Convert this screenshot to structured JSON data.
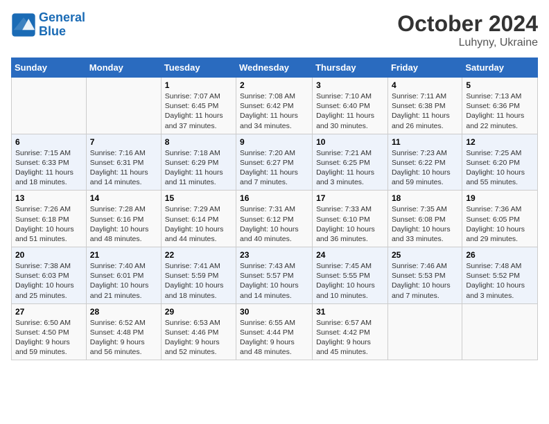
{
  "logo": {
    "line1": "General",
    "line2": "Blue"
  },
  "title": "October 2024",
  "subtitle": "Luhyny, Ukraine",
  "days_header": [
    "Sunday",
    "Monday",
    "Tuesday",
    "Wednesday",
    "Thursday",
    "Friday",
    "Saturday"
  ],
  "weeks": [
    [
      {
        "num": "",
        "info": ""
      },
      {
        "num": "",
        "info": ""
      },
      {
        "num": "1",
        "info": "Sunrise: 7:07 AM\nSunset: 6:45 PM\nDaylight: 11 hours and 37 minutes."
      },
      {
        "num": "2",
        "info": "Sunrise: 7:08 AM\nSunset: 6:42 PM\nDaylight: 11 hours and 34 minutes."
      },
      {
        "num": "3",
        "info": "Sunrise: 7:10 AM\nSunset: 6:40 PM\nDaylight: 11 hours and 30 minutes."
      },
      {
        "num": "4",
        "info": "Sunrise: 7:11 AM\nSunset: 6:38 PM\nDaylight: 11 hours and 26 minutes."
      },
      {
        "num": "5",
        "info": "Sunrise: 7:13 AM\nSunset: 6:36 PM\nDaylight: 11 hours and 22 minutes."
      }
    ],
    [
      {
        "num": "6",
        "info": "Sunrise: 7:15 AM\nSunset: 6:33 PM\nDaylight: 11 hours and 18 minutes."
      },
      {
        "num": "7",
        "info": "Sunrise: 7:16 AM\nSunset: 6:31 PM\nDaylight: 11 hours and 14 minutes."
      },
      {
        "num": "8",
        "info": "Sunrise: 7:18 AM\nSunset: 6:29 PM\nDaylight: 11 hours and 11 minutes."
      },
      {
        "num": "9",
        "info": "Sunrise: 7:20 AM\nSunset: 6:27 PM\nDaylight: 11 hours and 7 minutes."
      },
      {
        "num": "10",
        "info": "Sunrise: 7:21 AM\nSunset: 6:25 PM\nDaylight: 11 hours and 3 minutes."
      },
      {
        "num": "11",
        "info": "Sunrise: 7:23 AM\nSunset: 6:22 PM\nDaylight: 10 hours and 59 minutes."
      },
      {
        "num": "12",
        "info": "Sunrise: 7:25 AM\nSunset: 6:20 PM\nDaylight: 10 hours and 55 minutes."
      }
    ],
    [
      {
        "num": "13",
        "info": "Sunrise: 7:26 AM\nSunset: 6:18 PM\nDaylight: 10 hours and 51 minutes."
      },
      {
        "num": "14",
        "info": "Sunrise: 7:28 AM\nSunset: 6:16 PM\nDaylight: 10 hours and 48 minutes."
      },
      {
        "num": "15",
        "info": "Sunrise: 7:29 AM\nSunset: 6:14 PM\nDaylight: 10 hours and 44 minutes."
      },
      {
        "num": "16",
        "info": "Sunrise: 7:31 AM\nSunset: 6:12 PM\nDaylight: 10 hours and 40 minutes."
      },
      {
        "num": "17",
        "info": "Sunrise: 7:33 AM\nSunset: 6:10 PM\nDaylight: 10 hours and 36 minutes."
      },
      {
        "num": "18",
        "info": "Sunrise: 7:35 AM\nSunset: 6:08 PM\nDaylight: 10 hours and 33 minutes."
      },
      {
        "num": "19",
        "info": "Sunrise: 7:36 AM\nSunset: 6:05 PM\nDaylight: 10 hours and 29 minutes."
      }
    ],
    [
      {
        "num": "20",
        "info": "Sunrise: 7:38 AM\nSunset: 6:03 PM\nDaylight: 10 hours and 25 minutes."
      },
      {
        "num": "21",
        "info": "Sunrise: 7:40 AM\nSunset: 6:01 PM\nDaylight: 10 hours and 21 minutes."
      },
      {
        "num": "22",
        "info": "Sunrise: 7:41 AM\nSunset: 5:59 PM\nDaylight: 10 hours and 18 minutes."
      },
      {
        "num": "23",
        "info": "Sunrise: 7:43 AM\nSunset: 5:57 PM\nDaylight: 10 hours and 14 minutes."
      },
      {
        "num": "24",
        "info": "Sunrise: 7:45 AM\nSunset: 5:55 PM\nDaylight: 10 hours and 10 minutes."
      },
      {
        "num": "25",
        "info": "Sunrise: 7:46 AM\nSunset: 5:53 PM\nDaylight: 10 hours and 7 minutes."
      },
      {
        "num": "26",
        "info": "Sunrise: 7:48 AM\nSunset: 5:52 PM\nDaylight: 10 hours and 3 minutes."
      }
    ],
    [
      {
        "num": "27",
        "info": "Sunrise: 6:50 AM\nSunset: 4:50 PM\nDaylight: 9 hours and 59 minutes."
      },
      {
        "num": "28",
        "info": "Sunrise: 6:52 AM\nSunset: 4:48 PM\nDaylight: 9 hours and 56 minutes."
      },
      {
        "num": "29",
        "info": "Sunrise: 6:53 AM\nSunset: 4:46 PM\nDaylight: 9 hours and 52 minutes."
      },
      {
        "num": "30",
        "info": "Sunrise: 6:55 AM\nSunset: 4:44 PM\nDaylight: 9 hours and 48 minutes."
      },
      {
        "num": "31",
        "info": "Sunrise: 6:57 AM\nSunset: 4:42 PM\nDaylight: 9 hours and 45 minutes."
      },
      {
        "num": "",
        "info": ""
      },
      {
        "num": "",
        "info": ""
      }
    ]
  ]
}
